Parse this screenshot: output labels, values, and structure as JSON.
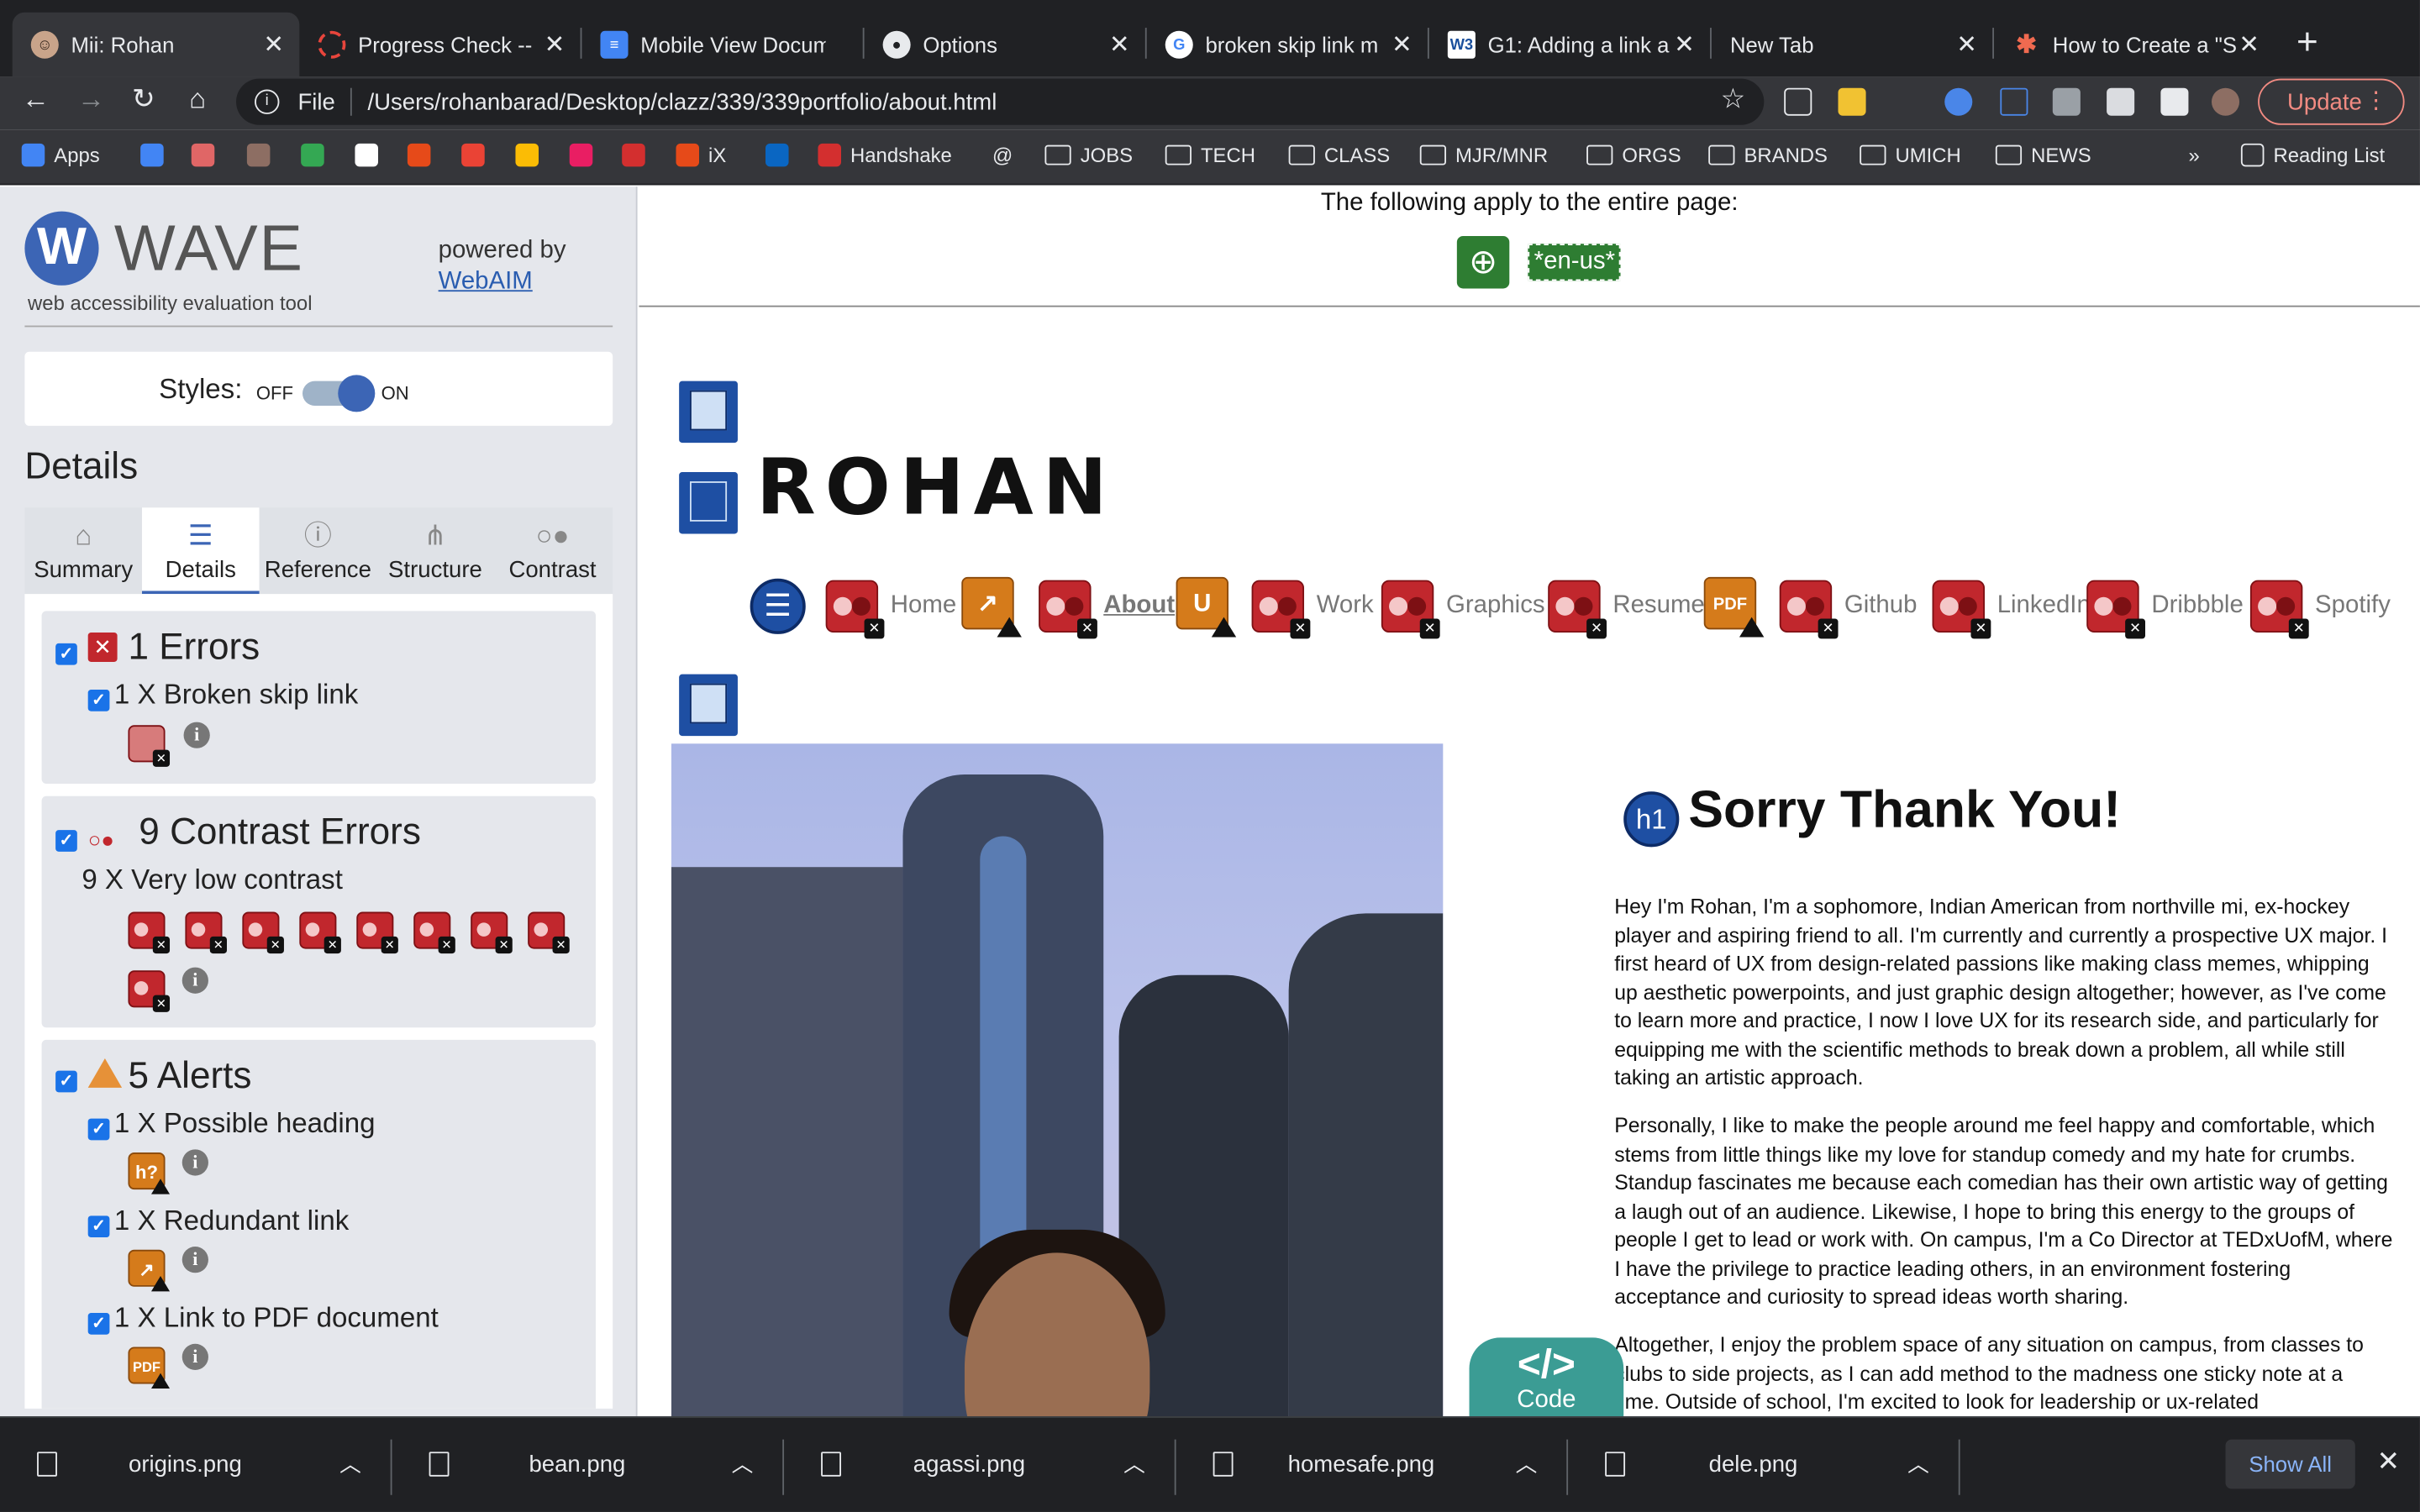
{
  "browser": {
    "tabs": [
      {
        "title": "Mii: Rohan",
        "active": true,
        "icon": "avatar-icon"
      },
      {
        "title": "Progress Check -- ",
        "icon": "spinner-icon"
      },
      {
        "title": "Mobile View Docum",
        "icon": "google-docs-icon"
      },
      {
        "title": "Options",
        "icon": "github-icon"
      },
      {
        "title": "broken skip link m",
        "icon": "google-icon"
      },
      {
        "title": "G1: Adding a link a",
        "icon": "w3c-icon"
      },
      {
        "title": "New Tab",
        "icon": ""
      },
      {
        "title": "How to Create a \"S",
        "icon": "asterisk-icon"
      }
    ],
    "address": {
      "scheme_label": "File",
      "url": "/Users/rohanbarad/Desktop/clazz/339/339portfolio/about.html"
    },
    "update_label": "Update",
    "bookmarks": [
      {
        "label": "Apps",
        "type": "apps"
      },
      {
        "label": "",
        "type": "icon",
        "color": "#4285f4"
      },
      {
        "label": "",
        "type": "icon",
        "color": "#e06666"
      },
      {
        "label": "",
        "type": "icon",
        "color": "#8d6e63"
      },
      {
        "label": "",
        "type": "icon",
        "color": "#34a853"
      },
      {
        "label": "",
        "type": "icon",
        "color": "#ffffff"
      },
      {
        "label": "",
        "type": "icon",
        "color": "#e64a19"
      },
      {
        "label": "",
        "type": "icon",
        "color": "#ea4335"
      },
      {
        "label": "",
        "type": "icon",
        "color": "#fbbc05"
      },
      {
        "label": "",
        "type": "icon",
        "color": "#e91e63"
      },
      {
        "label": "",
        "type": "icon",
        "color": "#d32f2f"
      },
      {
        "label": "iX",
        "type": "icon",
        "color": "#e64a19"
      },
      {
        "label": "",
        "type": "icon",
        "color": "#0a66c2"
      },
      {
        "label": "Handshake",
        "type": "icon",
        "color": "#d32f2f"
      },
      {
        "label": "",
        "type": "at"
      },
      {
        "label": "JOBS",
        "type": "folder"
      },
      {
        "label": "TECH",
        "type": "folder"
      },
      {
        "label": "CLASS",
        "type": "folder"
      },
      {
        "label": "MJR/MNR",
        "type": "folder"
      },
      {
        "label": "ORGS",
        "type": "folder"
      },
      {
        "label": "BRANDS",
        "type": "folder"
      },
      {
        "label": "UMICH",
        "type": "folder"
      },
      {
        "label": "NEWS",
        "type": "folder"
      }
    ],
    "more_bookmarks": "»",
    "reading_list": "Reading List"
  },
  "wave": {
    "title": "WAVE",
    "subtitle": "web accessibility evaluation tool",
    "powered_by": "powered by",
    "webaim": "WebAIM",
    "styles_label": "Styles:",
    "off_label": "OFF",
    "on_label": "ON",
    "details_heading": "Details",
    "tabs": [
      {
        "label": "Summary",
        "icon": "home-icon"
      },
      {
        "label": "Details",
        "icon": "list-icon",
        "active": true
      },
      {
        "label": "Reference",
        "icon": "info-icon"
      },
      {
        "label": "Structure",
        "icon": "structure-icon"
      },
      {
        "label": "Contrast",
        "icon": "contrast-icon"
      }
    ],
    "errors": {
      "title": "1 Errors",
      "items": [
        {
          "label": "1 X Broken skip link"
        }
      ]
    },
    "contrast": {
      "title": "9 Contrast Errors",
      "subtitle": "9 X Very low contrast",
      "count": 9
    },
    "alerts": {
      "title": "5 Alerts",
      "items": [
        {
          "label": "1 X Possible heading",
          "icon_text": "h?"
        },
        {
          "label": "1 X Redundant link",
          "icon_text": "↗"
        },
        {
          "label": "1 X Link to PDF document",
          "icon_text": "PDF"
        }
      ]
    }
  },
  "page": {
    "applies_text": "The following apply to the entire page:",
    "lang_badge": "*en-us*",
    "logo_text": "ROHAN",
    "nav": [
      {
        "label": "Home"
      },
      {
        "label": "About",
        "current": true
      },
      {
        "label": "Work"
      },
      {
        "label": "Graphics"
      },
      {
        "label": "Resume"
      },
      {
        "label": "Github"
      },
      {
        "label": "LinkedIn"
      },
      {
        "label": "Dribbble"
      },
      {
        "label": "Spotify"
      }
    ],
    "h1_badge": "h1",
    "heading": "Sorry Thank You!",
    "paragraphs": [
      "Hey I'm Rohan, I'm a sophomore, Indian American from northville mi, ex-hockey player and aspiring friend to all. I'm currently and currently a prospective UX major. I first heard of UX from design-related passions like making class memes, whipping up aesthetic powerpoints, and just graphic design altogether; however, as I've come to learn more and practice, I now I love UX for its research side, and particularly for equipping me with the scientific methods to break down a problem, all while still taking an artistic approach.",
      "Personally, I like to make the people around me feel happy and comfortable, which stems from little things like my love for standup comedy and my hate for crumbs. Standup fascinates me because each comedian has their own artistic way of getting a laugh out of an audience. Likewise, I hope to bring this energy to the groups of people I get to lead or work with. On campus, I'm a Co Director at TEDxUofM, where I have the privilege to practice leading others, in an environment fostering acceptance and curiosity to spread ideas worth sharing.",
      "Altogether, I enjoy the problem space of any situation on campus, from classes to clubs to side projects, as I can add method to the madness one sticky note at a time. Outside of school, I'm excited to look for leadership or ux-related"
    ],
    "code_badge": {
      "symbol": "</>",
      "label": "Code"
    }
  },
  "downloads": {
    "files": [
      "origins.png",
      "bean.png",
      "agassi.png",
      "homesafe.png",
      "dele.png"
    ],
    "show_all": "Show All"
  }
}
